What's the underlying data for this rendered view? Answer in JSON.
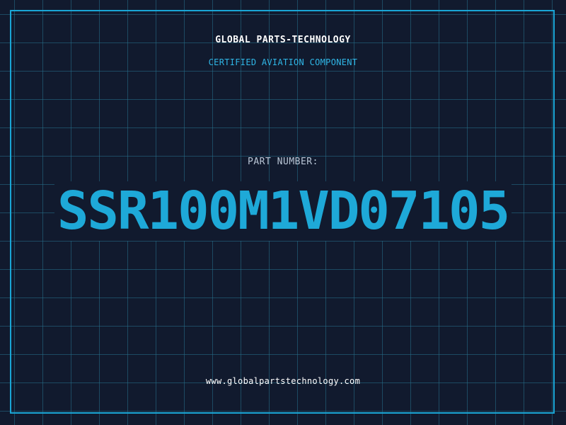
{
  "header": {
    "company": "GLOBAL PARTS-TECHNOLOGY",
    "subtitle": "CERTIFIED AVIATION COMPONENT"
  },
  "part": {
    "label": "PART NUMBER:",
    "number": "SSR100M1VD07105"
  },
  "footer": {
    "website": "www.globalpartstechnology.com"
  },
  "colors": {
    "background": "#111a2e",
    "grid": "#26708c",
    "accent": "#1ea9d8",
    "frame": "#1aa6d6",
    "label": "#b9c6d6",
    "text": "#ffffff"
  }
}
